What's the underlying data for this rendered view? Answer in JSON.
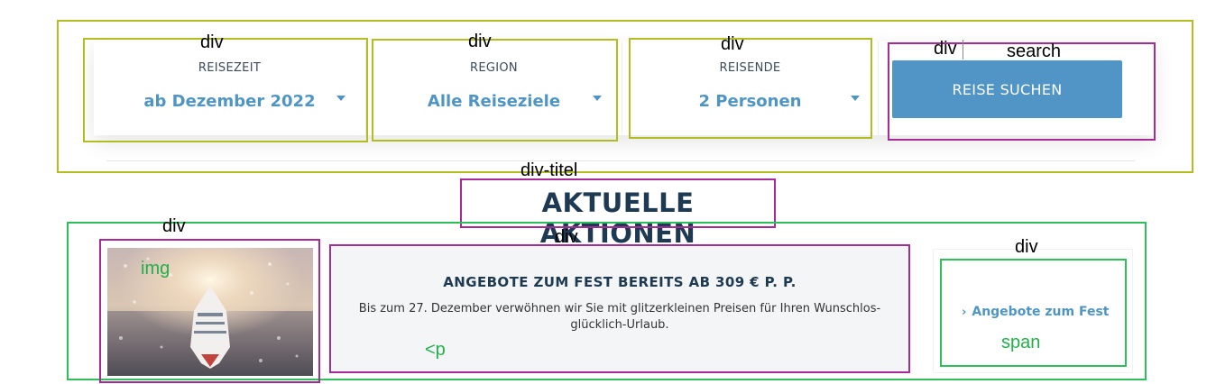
{
  "labels": {
    "div": "div",
    "search": "search",
    "div_titel": "div-titel",
    "img": "img",
    "p": "<p",
    "span": "span"
  },
  "search": {
    "fields": [
      {
        "caption": "REISEZEIT",
        "value": "ab Dezember 2022"
      },
      {
        "caption": "REGION",
        "value": "Alle Reiseziele"
      },
      {
        "caption": "REISENDE",
        "value": "2 Personen"
      }
    ],
    "button_label": "REISE SUCHEN"
  },
  "section": {
    "title": "AKTUELLE AKTIONEN"
  },
  "promo": {
    "headline": "ANGEBOTE ZUM FEST BEREITS AB 309 € P. P.",
    "text": "Bis zum 27. Dezember verwöhnen wir Sie mit glitzerkleinen Preisen für Ihren Wunschlos-glücklich-Urlaub.",
    "link_label": "Angebote zum Fest",
    "link_icon": "chevron-right-icon"
  },
  "colors": {
    "accent": "#4f95c4",
    "button": "#5194c6",
    "title": "#1e3a53",
    "annotation_olive": "#b3bd22",
    "annotation_purple": "#a62b96",
    "annotation_green": "#2fbf5a"
  }
}
